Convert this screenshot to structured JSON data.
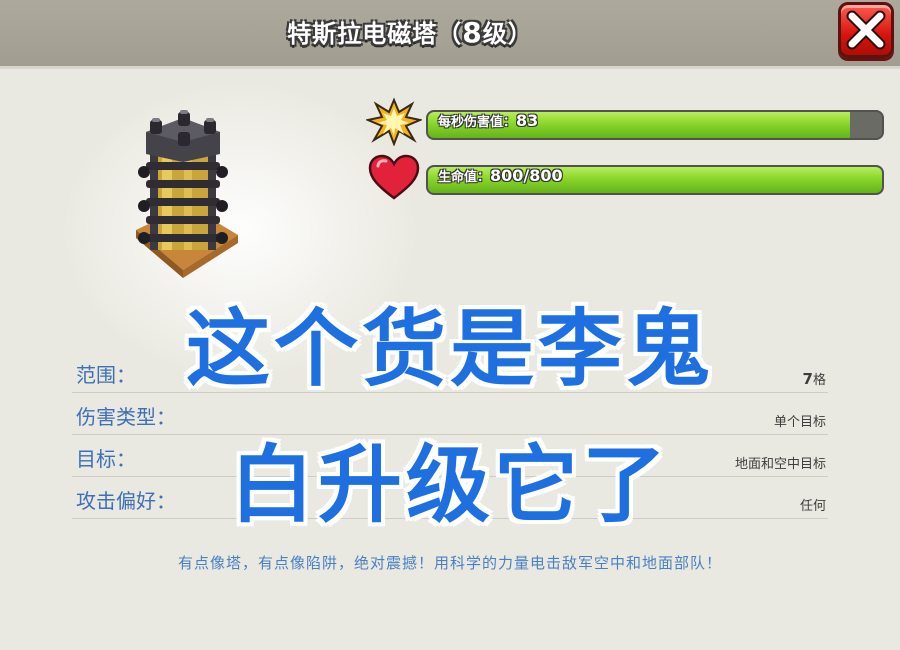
{
  "header": {
    "title_prefix": "特斯拉电磁塔（",
    "level": "8",
    "title_suffix": "级）",
    "close_label": "X"
  },
  "stats": [
    {
      "icon": "damage-explosion-icon",
      "label": "每秒伤害值：",
      "value": "83",
      "fill_fraction": 0.93
    },
    {
      "icon": "heart-icon",
      "label": "生命值：",
      "value": "800/800",
      "fill_fraction": 1.0
    }
  ],
  "info": [
    {
      "key": "范围：",
      "value_num": "7",
      "value_text": "格"
    },
    {
      "key": "伤害类型：",
      "value_num": "",
      "value_text": "单个目标"
    },
    {
      "key": "目标：",
      "value_num": "",
      "value_text": "地面和空中目标"
    },
    {
      "key": "攻击偏好：",
      "value_num": "",
      "value_text": "任何"
    }
  ],
  "description": "有点像塔，有点像陷阱，绝对震撼！用科学的力量电击敌军空中和地面部队！",
  "overlay": {
    "line1": "这个货是李鬼",
    "line2": "白升级它了"
  },
  "colors": {
    "bar_green": "#8ad52a",
    "close_red": "#d8140c",
    "overlay_blue": "#1e6fe0",
    "info_blue": "#3f6fb6"
  }
}
